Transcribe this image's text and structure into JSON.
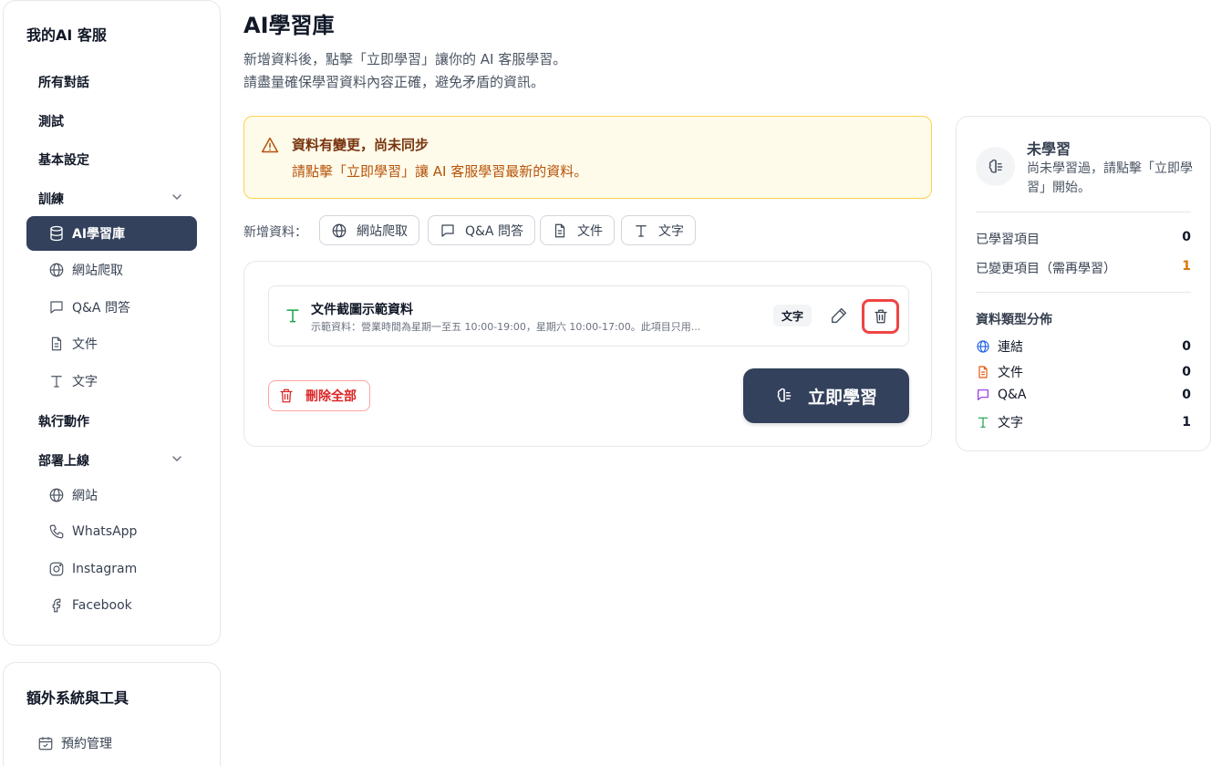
{
  "sidebar": {
    "title": "我的AI 客服",
    "items": {
      "all_chats": "所有對話",
      "test": "測試",
      "basic_settings": "基本設定",
      "training": "訓練",
      "training_sub": [
        "AI學習庫",
        "網站爬取",
        "Q&A 問答",
        "文件",
        "文字"
      ],
      "actions": "執行動作",
      "deploy": "部署上線",
      "deploy_sub": [
        "網站",
        "WhatsApp",
        "Instagram",
        "Facebook"
      ]
    }
  },
  "extra": {
    "title": "額外系統與工具",
    "items": [
      "預約管理"
    ]
  },
  "main": {
    "title": "AI學習庫",
    "desc1": "新增資料後，點擊「立即學習」讓你的 AI 客服學習。",
    "desc2": "請盡量確保學習資料內容正確，避免矛盾的資訊。",
    "alert": {
      "title": "資料有變更，尚未同步",
      "body": "請點擊「立即學習」讓 AI 客服學習最新的資料。"
    },
    "add_label": "新增資料：",
    "add_buttons": [
      "網站爬取",
      "Q&A 問答",
      "文件",
      "文字"
    ],
    "item": {
      "title": "文件截圖示範資料",
      "subtitle": "示範資料：營業時間為星期一至五 10:00-19:00，星期六 10:00-17:00。此項目只用...",
      "badge": "文字"
    },
    "delete_all": "刪除全部",
    "learn_now": "立即學習"
  },
  "panel": {
    "status": "未學習",
    "message": "尚未學習過，請點擊「立即學習」開始。",
    "learned_label": "已學習項目",
    "learned_value": "0",
    "changed_label": "已變更項目（需再學習）",
    "changed_value": "1",
    "dist_title": "資料類型分佈",
    "dist": [
      {
        "label": "連結",
        "value": "0"
      },
      {
        "label": "文件",
        "value": "0"
      },
      {
        "label": "Q&A",
        "value": "0"
      },
      {
        "label": "文字",
        "value": "1"
      }
    ]
  },
  "colors": {
    "accent": "#33415c",
    "warning_bg": "#fffbeb",
    "warning_text": "#b45309",
    "danger": "#ef4444",
    "link_blue": "#2563eb",
    "doc_orange": "#ea580c",
    "qa_purple": "#9333ea",
    "text_green": "#16a34a"
  }
}
